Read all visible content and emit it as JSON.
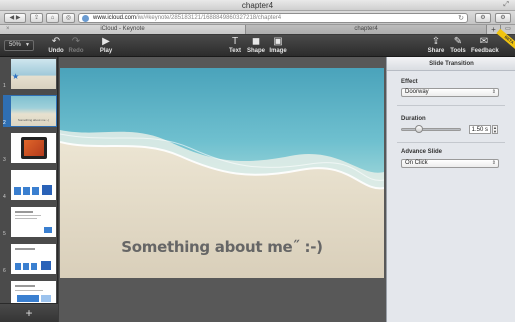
{
  "window": {
    "title": "chapter4"
  },
  "browser": {
    "url_domain": "www.icloud.com",
    "url_path": "/iw/#keynote/285183121/1688849860327218/chapter4",
    "tabs": [
      {
        "label": "iCloud - Keynote"
      },
      {
        "label": "chapter4"
      }
    ],
    "add_tab_label": "+"
  },
  "toolbar": {
    "zoom": "50%",
    "undo": "Undo",
    "redo": "Redo",
    "play": "Play",
    "text": "Text",
    "shape": "Shape",
    "image": "Image",
    "share": "Share",
    "tools": "Tools",
    "feedback": "Feedback",
    "beta": "BETA"
  },
  "navigator": {
    "slide_numbers": [
      "1",
      "2",
      "3",
      "4",
      "5",
      "6",
      "7"
    ],
    "thumb2_caption": "Something about me :-)",
    "add_label": "+"
  },
  "slide": {
    "caption": "Something about me˝ :-)"
  },
  "inspector": {
    "title": "Slide Transition",
    "effect_label": "Effect",
    "effect_value": "Doorway",
    "duration_label": "Duration",
    "duration_value": "1.50 s",
    "advance_label": "Advance Slide",
    "advance_value": "On Click"
  }
}
